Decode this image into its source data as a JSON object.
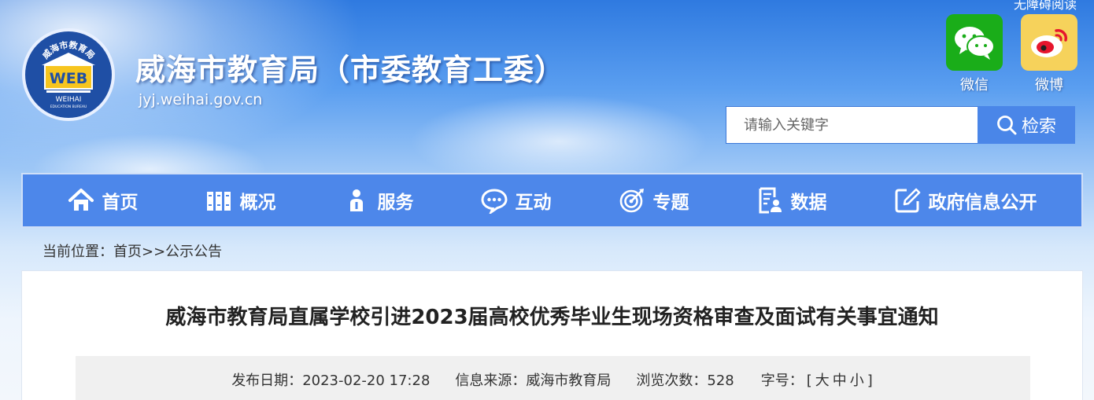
{
  "header": {
    "site_title": "威海市教育局（市委教育工委）",
    "site_url": "jyj.weihai.gov.cn",
    "top_link": "无障碍阅读",
    "logo": {
      "top_text": "威海市教育局",
      "center_text": "WEB",
      "bottom_text": "WEIHAI",
      "sub_text": "EDUCATION BUREAU"
    },
    "social": [
      {
        "label": "微信",
        "icon": "wechat-icon",
        "color": "#1aad19"
      },
      {
        "label": "微博",
        "icon": "weibo-icon",
        "color": "#f6d25b"
      }
    ],
    "search": {
      "placeholder": "请输入关键字",
      "button_label": "检索"
    }
  },
  "nav": {
    "items": [
      {
        "label": "首页",
        "icon": "home-icon"
      },
      {
        "label": "概况",
        "icon": "books-icon"
      },
      {
        "label": "服务",
        "icon": "person-icon"
      },
      {
        "label": "互动",
        "icon": "chat-icon"
      },
      {
        "label": "专题",
        "icon": "target-icon"
      },
      {
        "label": "数据",
        "icon": "document-person-icon"
      },
      {
        "label": "政府信息公开",
        "icon": "edit-icon"
      }
    ]
  },
  "breadcrumb": {
    "label": "当前位置：",
    "home": "首页",
    "sep": ">>",
    "current": "公示公告"
  },
  "article": {
    "title": "威海市教育局直属学校引进2023届高校优秀毕业生现场资格审查及面试有关事宜通知",
    "meta": {
      "date_label": "发布日期：",
      "date": "2023-02-20 17:28",
      "source_label": "信息来源：",
      "source": "威海市教育局",
      "views_label": "浏览次数：",
      "views": "528",
      "font_label": "字号：",
      "font_open": "[",
      "font_large": "大",
      "font_medium": "中",
      "font_small": "小",
      "font_close": "]"
    }
  },
  "colors": {
    "nav_bg": "#4d87ea",
    "search_btn": "#4a86e8",
    "logo_bg": "#1f4fa5"
  }
}
